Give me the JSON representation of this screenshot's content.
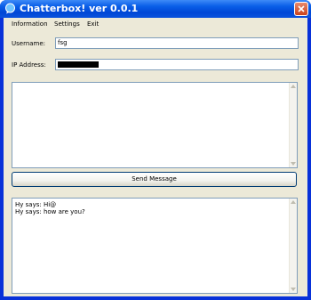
{
  "window": {
    "title": "Chatterbox! ver 0.0.1"
  },
  "menu": {
    "items": [
      "Information",
      "Settings",
      "Exit"
    ]
  },
  "form": {
    "username_label": "Username:",
    "username_value": "fsg",
    "ip_label": "IP Address:",
    "ip_value_redacted": true
  },
  "compose": {
    "value": ""
  },
  "send_button": {
    "label": "Send Message"
  },
  "messages": [
    "Hy says: Hi@",
    "Hy says: how are you?"
  ],
  "colors": {
    "titlebar": "#0a5fe8",
    "window_bg": "#ece9d8",
    "field_border": "#7f9db9",
    "button_border": "#003c74"
  }
}
